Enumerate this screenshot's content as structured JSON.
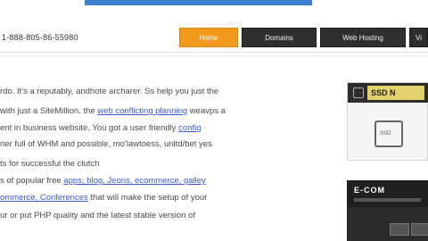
{
  "header": {
    "phone": "1-888-805-86-55980",
    "nav": [
      {
        "label": "Home",
        "active": true
      },
      {
        "label": "Domains",
        "active": false
      },
      {
        "label": "Web Hosting",
        "active": false
      },
      {
        "label": "Vi",
        "active": false
      }
    ]
  },
  "content": {
    "lines": [
      {
        "parts": [
          {
            "text": "rdo. It's a reputably, andhote archarer. Ss help you just the",
            "link": false
          }
        ]
      },
      {
        "parts": [
          {
            "text": "with just a SiteMillion. the ",
            "link": false
          },
          {
            "text": "web conflicting planning",
            "link": true
          },
          {
            "text": " weavps a",
            "link": false
          }
        ]
      },
      {
        "parts": [
          {
            "text": "ent in business website. You got a user friendly ",
            "link": false
          },
          {
            "text": "config",
            "link": true
          }
        ]
      },
      {
        "parts": [
          {
            "text": "ner full of WHM and possible, mo'lawtoess, unltd/bet yes",
            "link": false
          }
        ]
      },
      {
        "parts": [
          {
            "text": "ts for successful the clutch",
            "link": false
          }
        ]
      },
      {
        "parts": [
          {
            "text": "s of popular free ",
            "link": false
          },
          {
            "text": "apps, blog, Jeons, ecommerce, galley",
            "link": true
          }
        ]
      },
      {
        "parts": [
          {
            "text": "ommerce, Conferences",
            "link": true
          },
          {
            "text": " that will make the setup of your",
            "link": false
          }
        ]
      },
      {
        "parts": [
          {
            "text": "ur or put PHP quality and the latest stable version of",
            "link": false
          }
        ]
      }
    ]
  },
  "sidebar": {
    "box1_title": "SSD N",
    "box1_text": "SSD",
    "box2_title": "E-COM",
    "box2_accent": "#e1d26a"
  },
  "colors": {
    "accent": "#f39a1c",
    "link": "#3b5bd6",
    "banner": "#3f7fd0"
  }
}
